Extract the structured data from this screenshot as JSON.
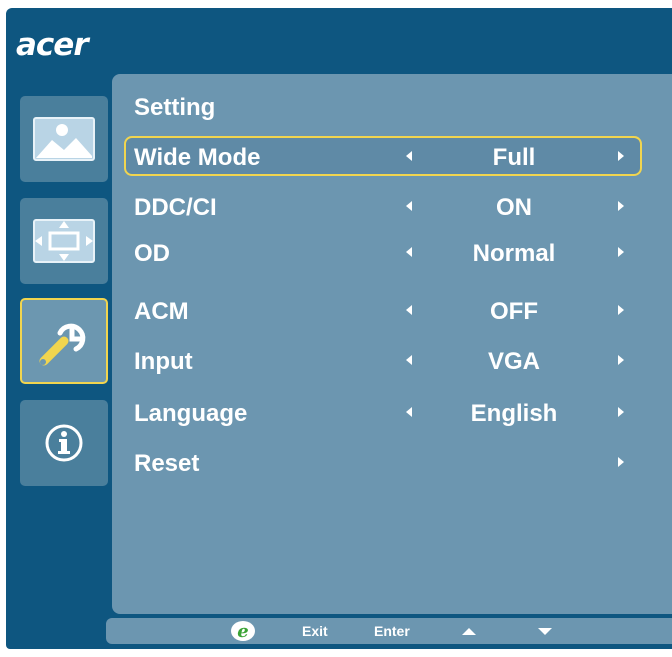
{
  "brand": {
    "logo_text": "acer"
  },
  "sidebar": {
    "items": [
      {
        "icon": "picture-icon",
        "active": false
      },
      {
        "icon": "position-icon",
        "active": false
      },
      {
        "icon": "setting-wrench-icon",
        "active": true
      },
      {
        "icon": "info-icon",
        "active": false
      }
    ]
  },
  "panel": {
    "title": "Setting",
    "rows": [
      {
        "label": "Wide Mode",
        "value": "Full",
        "selected": true
      },
      {
        "label": "DDC/CI",
        "value": "ON"
      },
      {
        "label": "OD",
        "value": "Normal"
      },
      {
        "label": "ACM",
        "value": "OFF"
      },
      {
        "label": "Input",
        "value": "VGA"
      },
      {
        "label": "Language",
        "value": "English"
      },
      {
        "label": "Reset",
        "value": ""
      }
    ]
  },
  "footer": {
    "exit_label": "Exit",
    "enter_label": "Enter"
  },
  "colors": {
    "frame": "#0e5680",
    "panel": "#6c96b0",
    "highlight": "#f1d54f",
    "e_key_green": "#3aa335"
  }
}
